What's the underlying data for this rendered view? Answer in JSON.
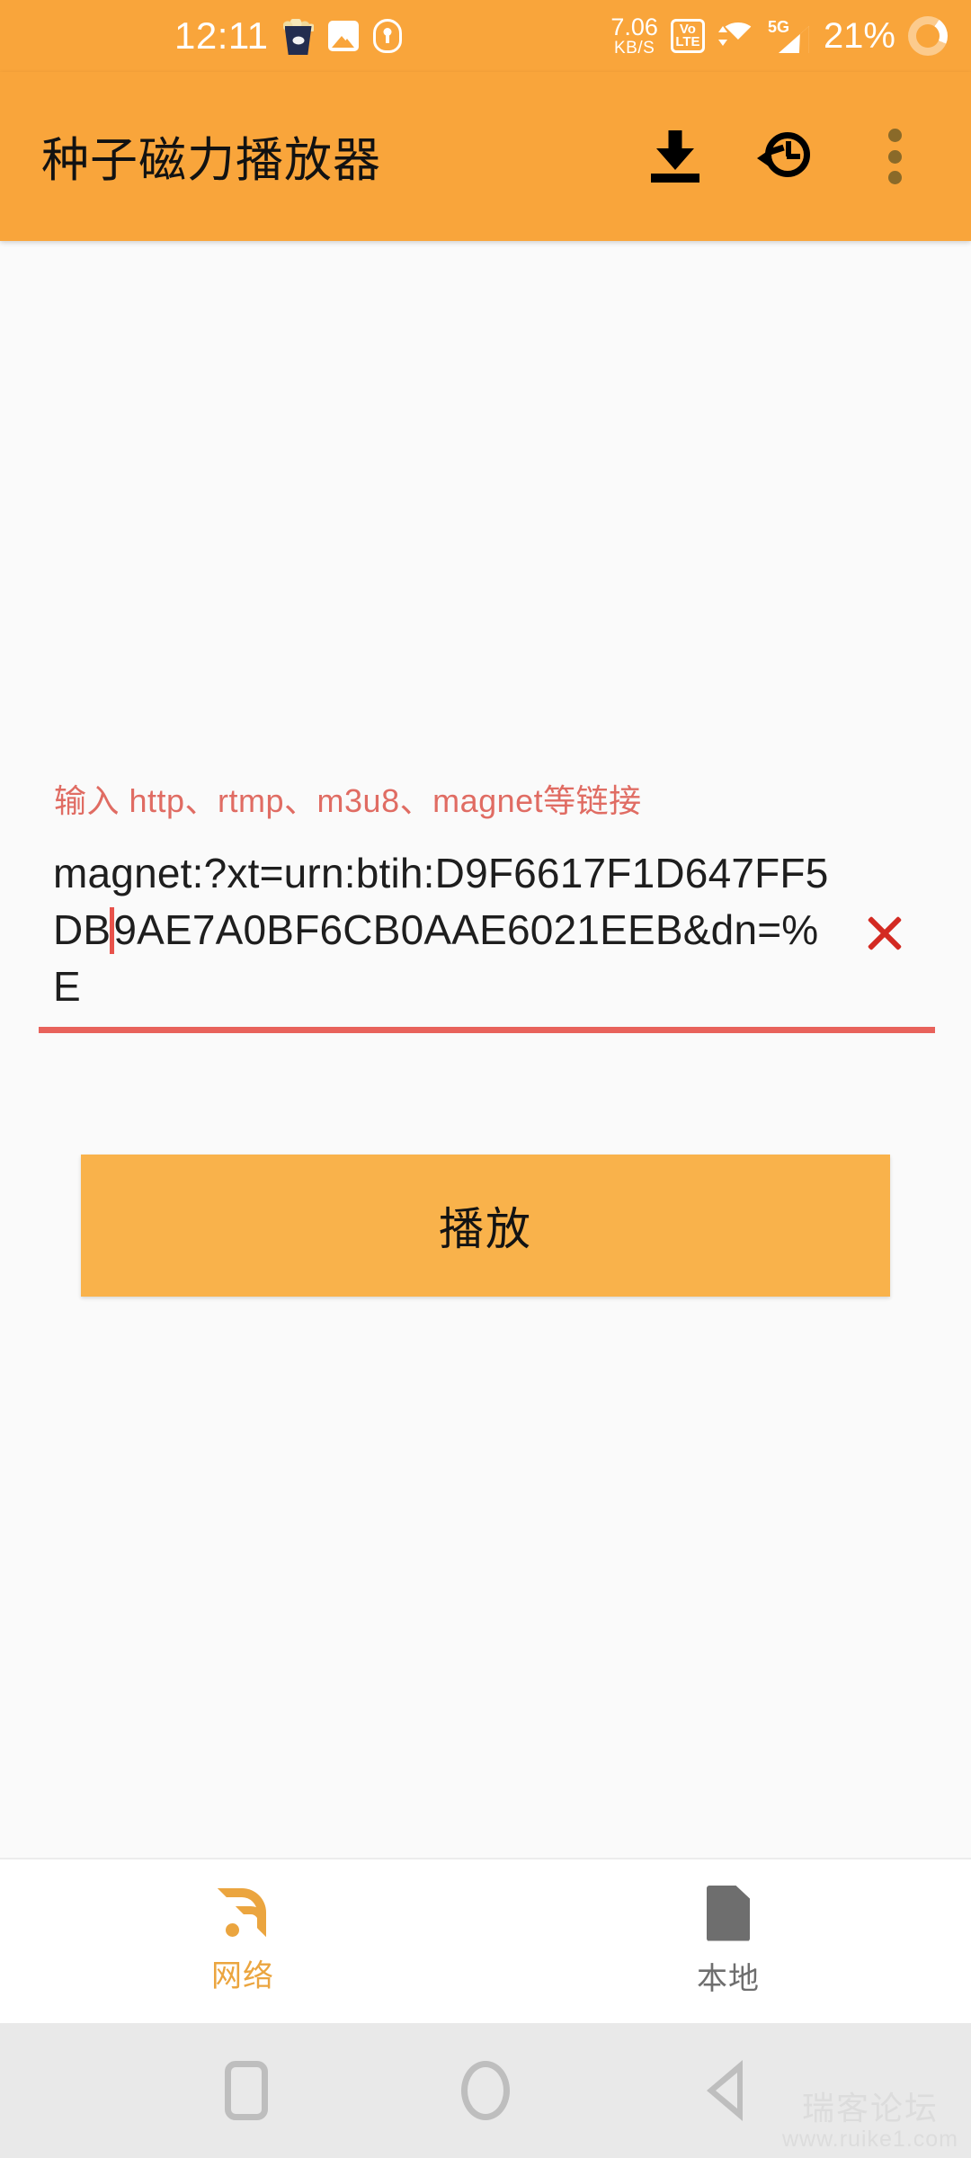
{
  "status_bar": {
    "time": "12:11",
    "left_icons": [
      "popcorn-app-icon",
      "gallery-icon",
      "location-shield-icon"
    ],
    "network_speed_value": "7.06",
    "network_speed_unit": "KB/S",
    "volte_top": "Vo",
    "volte_bottom": "LTE",
    "signal_generation": "5G",
    "battery_percent": "21%",
    "background_color": "#F9A53B"
  },
  "app_bar": {
    "title": "种子磁力播放器",
    "actions": [
      {
        "name": "download-button",
        "icon": "download-icon"
      },
      {
        "name": "history-button",
        "icon": "history-clock-icon"
      },
      {
        "name": "overflow-menu-button",
        "icon": "more-vertical-icon"
      }
    ],
    "background_color": "#F9A53B",
    "title_color": "#121212"
  },
  "main": {
    "input_hint": "输入 http、rtmp、m3u8、magnet等链接",
    "hint_color": "#E06C63",
    "url_field": {
      "value_part1": "magnet:?xt=urn:btih:D9F6617F1D647FF5DB",
      "value_part2": "9AE7A0BF6CB0AAE6021EEB&dn=%E",
      "placeholder": "输入 http、rtmp、m3u8、magnet等链接",
      "underline_color": "#E8625B",
      "caret_color": "#E8524B"
    },
    "clear_button_label": "清除",
    "play_button_label": "播放",
    "play_button_color": "#F9B24B"
  },
  "bottom_nav": {
    "items": [
      {
        "label": "网络",
        "icon": "rss-signal-icon",
        "active": true,
        "color": "#EBA53F"
      },
      {
        "label": "本地",
        "icon": "document-icon",
        "active": false,
        "color": "#6E6E6E"
      }
    ]
  },
  "android_nav": {
    "buttons": [
      {
        "name": "recents-button",
        "icon": "square-icon"
      },
      {
        "name": "home-button",
        "icon": "circle-icon"
      },
      {
        "name": "back-button",
        "icon": "triangle-left-icon"
      }
    ],
    "background_color": "#E9E9E9"
  },
  "watermark": {
    "line1": "瑞客论坛",
    "line2": "www.ruike1.com"
  }
}
